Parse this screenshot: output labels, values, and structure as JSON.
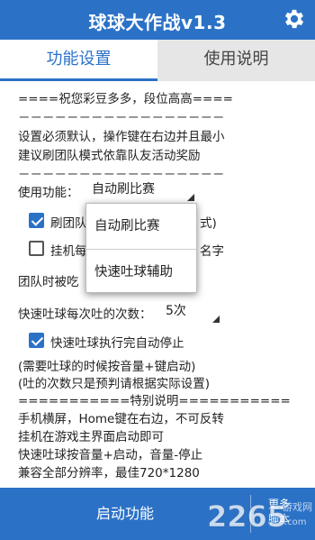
{
  "app": {
    "title": "球球大作战v1.3"
  },
  "tabs": [
    {
      "label": "功能设置",
      "active": true
    },
    {
      "label": "使用说明",
      "active": false
    }
  ],
  "intro_lines": [
    "====祝您彩豆多多，段位高高====",
    "－－－－－－－－－－－－－－－－－",
    "设置必须默认，操作键在右边并且最小",
    "建议刷团队模式依靠队友活动奖励",
    "－－－－－－－－－－－－－－－－－"
  ],
  "function": {
    "label": "使用功能：",
    "selected": "自动刷比赛",
    "options": [
      "自动刷比赛",
      "快速吐球辅助"
    ]
  },
  "checkbox_team": {
    "label_left": "刷团队",
    "label_right": "式)",
    "checked": true
  },
  "checkbox_hang": {
    "label_left": "挂机每",
    "label_right": "名字",
    "checked": false
  },
  "team_eaten_label": "团队时被吃",
  "spit_count": {
    "label": "快速吐球每次吐的次数：",
    "value": "5次"
  },
  "checkbox_auto_stop": {
    "label": "快速吐球执行完自动停止",
    "checked": true
  },
  "notes": [
    "(需要吐球的时候按音量+键启动)",
    "(吐的次数只是预判请根据实际设置)",
    "===========特别说明===========",
    "手机横屏，Home键在右边，不可反转",
    "挂机在游戏主界面启动即可",
    "快速吐球按音量+启动，音量-停止",
    "兼容全部分辨率，最佳720*1280"
  ],
  "bottom": {
    "start_label": "启动功能",
    "more_line1": "更多",
    "more_line2": "脚本"
  },
  "watermark": {
    "text": "2265",
    "sub": "游戏网",
    "domain": ".com"
  },
  "colors": {
    "primary": "#2b72c7",
    "tab_inactive_bg": "#e6e6e6",
    "white": "#ffffff"
  }
}
